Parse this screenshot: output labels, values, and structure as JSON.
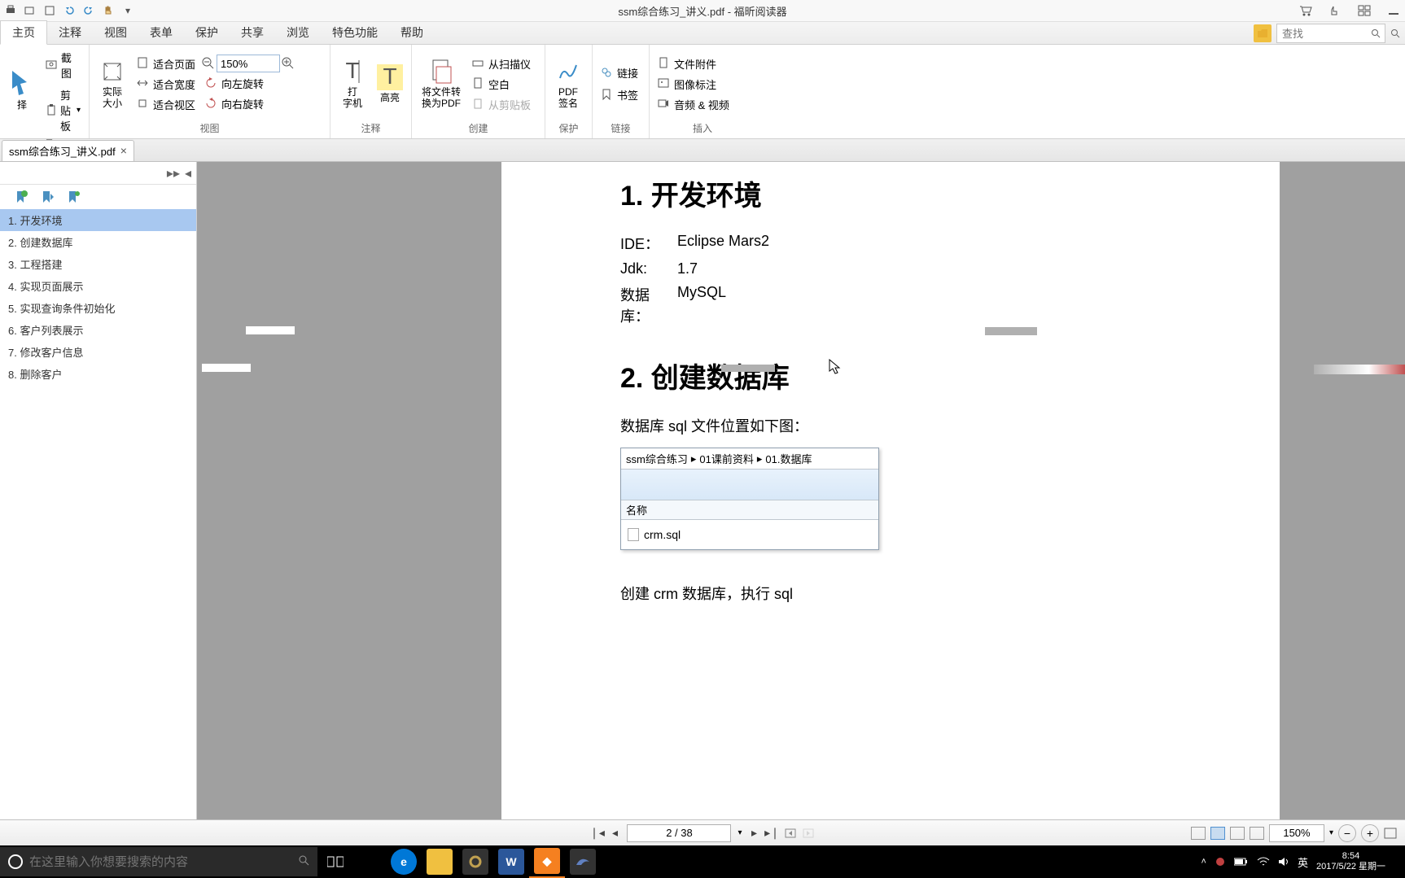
{
  "titlebar": {
    "title": "ssm综合练习_讲义.pdf - 福昕阅读器"
  },
  "menu": {
    "tabs": [
      "主页",
      "注释",
      "视图",
      "表单",
      "保护",
      "共享",
      "浏览",
      "特色功能",
      "帮助"
    ],
    "active": 0,
    "search_placeholder": "查找"
  },
  "ribbon": {
    "groups": [
      {
        "label": "工具",
        "items": {
          "select": "择",
          "screenshot": "截图",
          "clipboard": "剪贴板"
        }
      },
      {
        "label": "视图",
        "items": {
          "actual": "实际\n大小",
          "fitpage": "适合页面",
          "fitwidth": "适合宽度",
          "fitvisible": "适合视区",
          "zoomval": "150%",
          "rotleft": "向左旋转",
          "rotright": "向右旋转"
        }
      },
      {
        "label": "注释",
        "items": {
          "typewriter": "打\n字机",
          "highlight": "高亮"
        }
      },
      {
        "label": "创建",
        "items": {
          "convert": "将文件转\n换为PDF",
          "scanner": "从扫描仪",
          "blank": "空白",
          "clip": "从剪贴板"
        }
      },
      {
        "label": "保护",
        "items": {
          "sign": "PDF\n签名"
        }
      },
      {
        "label": "链接",
        "items": {
          "link": "链接",
          "bookmark": "书签"
        }
      },
      {
        "label": "插入",
        "items": {
          "attach": "文件附件",
          "imgnote": "图像标注",
          "av": "音频 & 视频"
        }
      }
    ]
  },
  "doctabs": [
    {
      "name": "ssm综合练习_讲义.pdf"
    }
  ],
  "bookmarks": [
    "1. 开发环境",
    "2. 创建数据库",
    "3. 工程搭建",
    "4. 实现页面展示",
    "5. 实现查询条件初始化",
    "6. 客户列表展示",
    "7. 修改客户信息",
    "8. 删除客户"
  ],
  "bookmarks_selected": 0,
  "document": {
    "h1_num": "1.",
    "h1_title": " 开发环境",
    "rows": [
      {
        "k": "IDE：",
        "v": "Eclipse Mars2"
      },
      {
        "k": "Jdk:",
        "v": "1.7"
      },
      {
        "k": "数据库：",
        "v": "MySQL"
      }
    ],
    "h2_num": "2.",
    "h2_title": " 创建数据库",
    "p1": "数据库 sql 文件位置如下图：",
    "p2": "创建 crm 数据库，执行 sql",
    "explorer": {
      "crumb": [
        "ssm综合练习",
        "▸",
        "01课前资料",
        "▸",
        "01.数据库"
      ],
      "col": "名称",
      "file": "crm.sql"
    }
  },
  "status": {
    "page_display": "2 / 38",
    "zoom": "150%"
  },
  "taskbar": {
    "search_placeholder": "在这里输入你想要搜索的内容",
    "ime": "英",
    "time": "8:54",
    "date": "2017/5/22 星期一"
  }
}
